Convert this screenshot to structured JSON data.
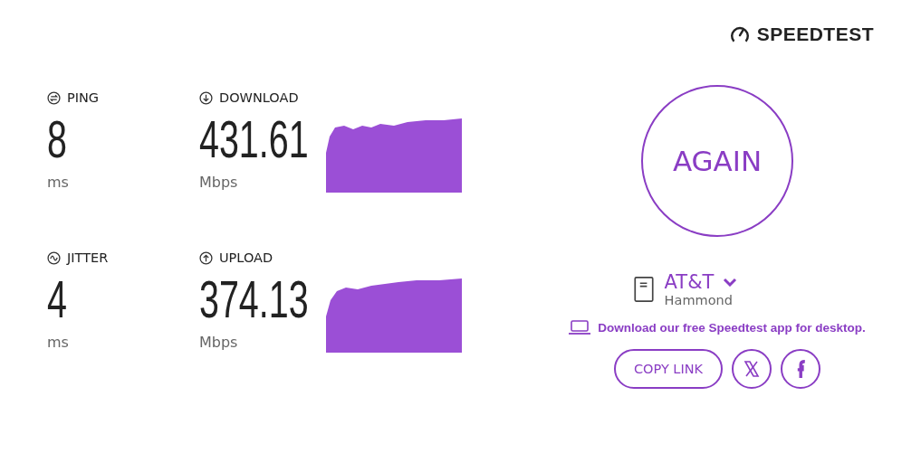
{
  "brand": "SPEEDTEST",
  "metrics": [
    {
      "kind": "ping",
      "label": "PING",
      "value": "8",
      "unit": "ms"
    },
    {
      "kind": "download",
      "label": "DOWNLOAD",
      "value": "431.61",
      "unit": "Mbps",
      "graph": true
    },
    {
      "kind": "jitter",
      "label": "JITTER",
      "value": "4",
      "unit": "ms"
    },
    {
      "kind": "upload",
      "label": "UPLOAD",
      "value": "374.13",
      "unit": "Mbps",
      "graph": true
    }
  ],
  "again_button": "AGAIN",
  "provider": {
    "name": "AT&T",
    "location": "Hammond"
  },
  "app_link": "Download our free Speedtest app for desktop.",
  "copy_link_button": "COPY LINK"
}
